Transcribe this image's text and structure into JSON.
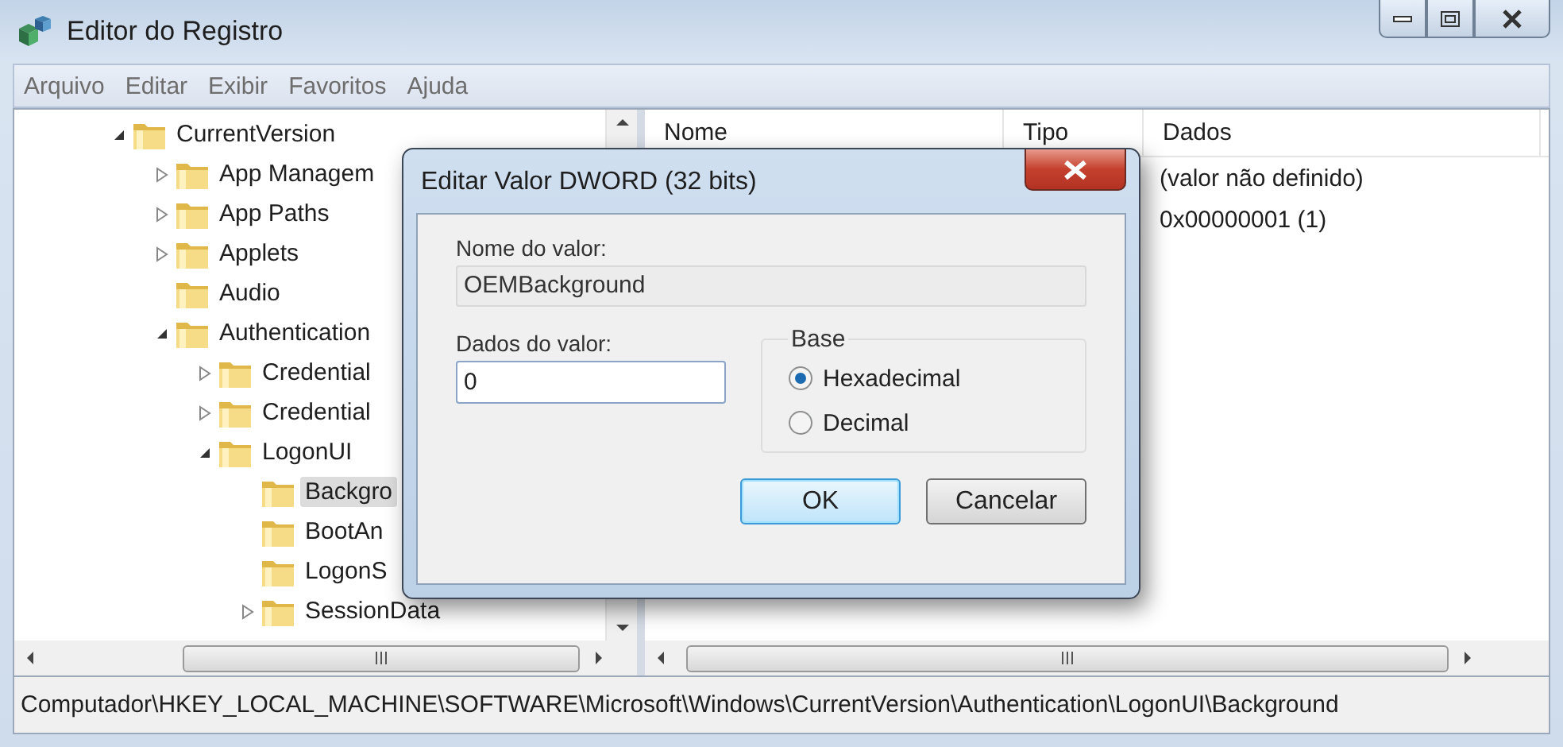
{
  "window": {
    "title": "Editor do Registro"
  },
  "menu": [
    "Arquivo",
    "Editar",
    "Exibir",
    "Favoritos",
    "Ajuda"
  ],
  "tree": [
    {
      "label": "CurrentVersion",
      "expanded": true,
      "selected": false,
      "children": [
        {
          "label": "App Managem",
          "expanded": false,
          "selected": false
        },
        {
          "label": "App Paths",
          "expanded": false,
          "selected": false
        },
        {
          "label": "Applets",
          "expanded": false,
          "selected": false
        },
        {
          "label": "Audio",
          "selected": false
        },
        {
          "label": "Authentication",
          "expanded": true,
          "selected": false,
          "children": [
            {
              "label": "Credential",
              "expanded": false,
              "selected": false
            },
            {
              "label": "Credential",
              "expanded": false,
              "selected": false
            },
            {
              "label": "LogonUI",
              "expanded": true,
              "selected": false,
              "children": [
                {
                  "label": "Backgro",
                  "selected": true
                },
                {
                  "label": "BootAn",
                  "selected": false
                },
                {
                  "label": "LogonS",
                  "selected": false
                },
                {
                  "label": "SessionData",
                  "expanded": false,
                  "selected": false
                }
              ]
            }
          ]
        }
      ]
    }
  ],
  "list": {
    "columns": [
      "Nome",
      "Tipo",
      "Dados"
    ],
    "rows": [
      {
        "data": "(valor não definido)"
      },
      {
        "data": "0x00000001 (1)"
      }
    ]
  },
  "status_bar": "Computador\\HKEY_LOCAL_MACHINE\\SOFTWARE\\Microsoft\\Windows\\CurrentVersion\\Authentication\\LogonUI\\Background",
  "dialog": {
    "title": "Editar Valor DWORD (32 bits)",
    "name_label": "Nome do valor:",
    "name_value": "OEMBackground",
    "data_label": "Dados do valor:",
    "data_value": "0",
    "base": {
      "label": "Base",
      "options": [
        {
          "label": "Hexadecimal",
          "selected": true
        },
        {
          "label": "Decimal",
          "selected": false
        }
      ]
    },
    "buttons": [
      {
        "label": "OK",
        "default": true
      },
      {
        "label": "Cancelar",
        "default": false
      }
    ]
  }
}
